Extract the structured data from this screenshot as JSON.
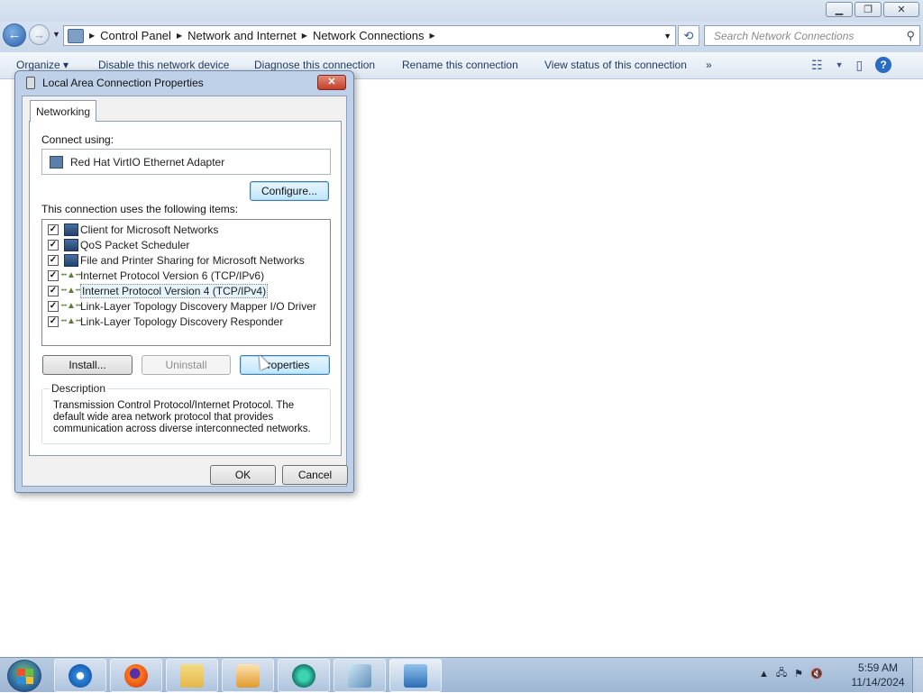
{
  "window": {
    "caption_buttons": [
      "minimize",
      "restore",
      "close"
    ]
  },
  "nav": {
    "breadcrumb": [
      "Control Panel",
      "Network and Internet",
      "Network Connections"
    ],
    "search_placeholder": "Search Network Connections"
  },
  "commandbar": {
    "organize": "Organize ▾",
    "disable": "Disable this network device",
    "diagnose": "Diagnose this connection",
    "rename": "Rename this connection",
    "view_status": "View status of this connection",
    "more": "»"
  },
  "dialog": {
    "title": "Local Area Connection Properties",
    "close_glyph": "✕",
    "tab": "Networking",
    "connect_using_label": "Connect using:",
    "adapter": "Red Hat VirtIO Ethernet Adapter",
    "configure": "Configure...",
    "items_label": "This connection uses the following items:",
    "items": [
      {
        "label": "Client for Microsoft Networks",
        "checked": true,
        "icon": "network-client-icon"
      },
      {
        "label": "QoS Packet Scheduler",
        "checked": true,
        "icon": "network-service-icon"
      },
      {
        "label": "File and Printer Sharing for Microsoft Networks",
        "checked": true,
        "icon": "network-service-icon"
      },
      {
        "label": "Internet Protocol Version 6 (TCP/IPv6)",
        "checked": true,
        "icon": "protocol-icon"
      },
      {
        "label": "Internet Protocol Version 4 (TCP/IPv4)",
        "checked": true,
        "icon": "protocol-icon",
        "selected": true
      },
      {
        "label": "Link-Layer Topology Discovery Mapper I/O Driver",
        "checked": true,
        "icon": "protocol-icon"
      },
      {
        "label": "Link-Layer Topology Discovery Responder",
        "checked": true,
        "icon": "protocol-icon"
      }
    ],
    "install": "Install...",
    "uninstall": "Uninstall",
    "properties": "Properties",
    "description_title": "Description",
    "description": "Transmission Control Protocol/Internet Protocol. The default wide area network protocol that provides communication across diverse interconnected networks.",
    "ok": "OK",
    "cancel": "Cancel"
  },
  "taskbar": {
    "apps": [
      "internet-explorer-icon",
      "firefox-icon",
      "file-explorer-icon",
      "media-player-icon",
      "app-icon",
      "app-icon",
      "network-connections-icon"
    ],
    "clock_time": "5:59 AM",
    "clock_date": "11/14/2024"
  }
}
